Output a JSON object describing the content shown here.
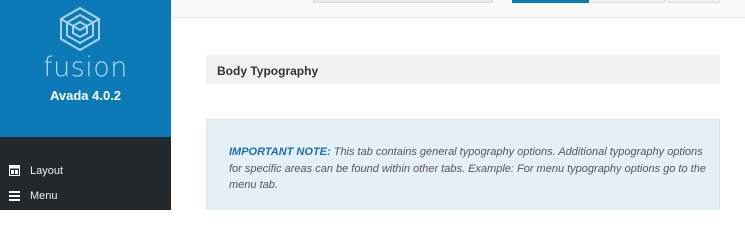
{
  "brand": {
    "name": "fusion",
    "product": "Avada 4.0.2",
    "color": "#0d7ab8"
  },
  "sidebar": {
    "items": [
      {
        "label": "Layout",
        "icon": "layout-icon"
      },
      {
        "label": "Menu",
        "icon": "menu-icon"
      }
    ]
  },
  "main": {
    "section_title": "Body Typography",
    "note": {
      "label": "IMPORTANT NOTE:",
      "text": "This tab contains general typography options. Additional typography options for specific areas can be found within other tabs. Example: For menu typography options go to the menu tab."
    }
  }
}
